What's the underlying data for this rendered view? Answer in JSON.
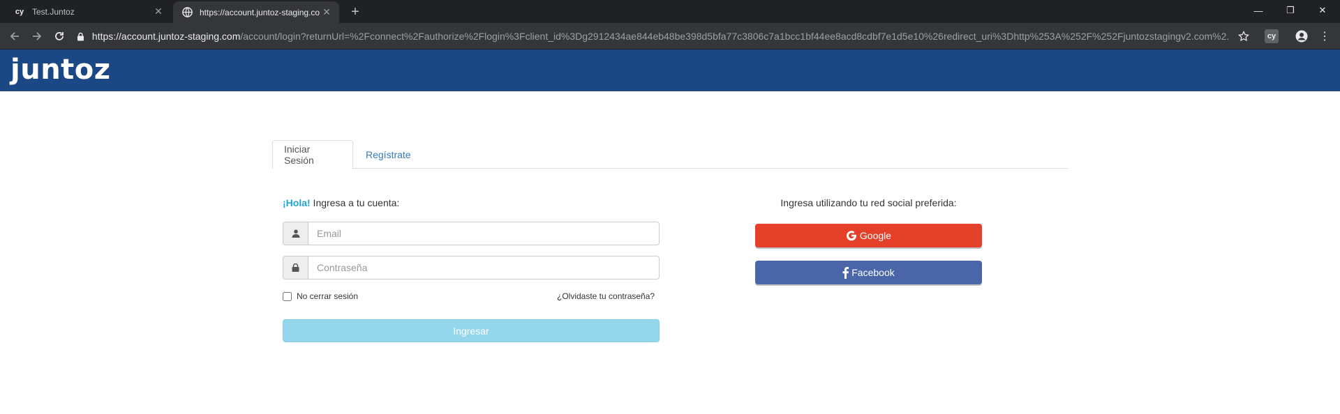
{
  "browser": {
    "tabs": [
      {
        "label": "Test.Juntoz",
        "favicon_text": "cy"
      },
      {
        "label": "https://account.juntoz-staging.co"
      }
    ],
    "url_host": "https://account.juntoz-staging.com",
    "url_path": "/account/login?returnUrl=%2Fconnect%2Fauthorize%2Flogin%3Fclient_id%3Dg2912434ae844eb48be398d5bfa77c3806c7a1bcc1bf44ee8acd8cdbf7e1d5e10%26redirect_uri%3Dhttp%253A%252F%252Fjuntozstagingv2.com%2...",
    "extension_label": "cy"
  },
  "site": {
    "logo": "juntoz",
    "header_color": "#1b4784"
  },
  "tabs": {
    "login": "Iniciar Sesión",
    "register": "Regístrate"
  },
  "login": {
    "greeting_bold": "¡Hola!",
    "greeting_rest": " Ingresa a tu cuenta:",
    "email_placeholder": "Email",
    "password_placeholder": "Contraseña",
    "remember_label": "No cerrar sesión",
    "forgot_label": "¿Olvidaste tu contraseña?",
    "submit_label": "Ingresar"
  },
  "social": {
    "label": "Ingresa utilizando tu red social preferida:",
    "google": "Google",
    "facebook": "Facebook"
  }
}
